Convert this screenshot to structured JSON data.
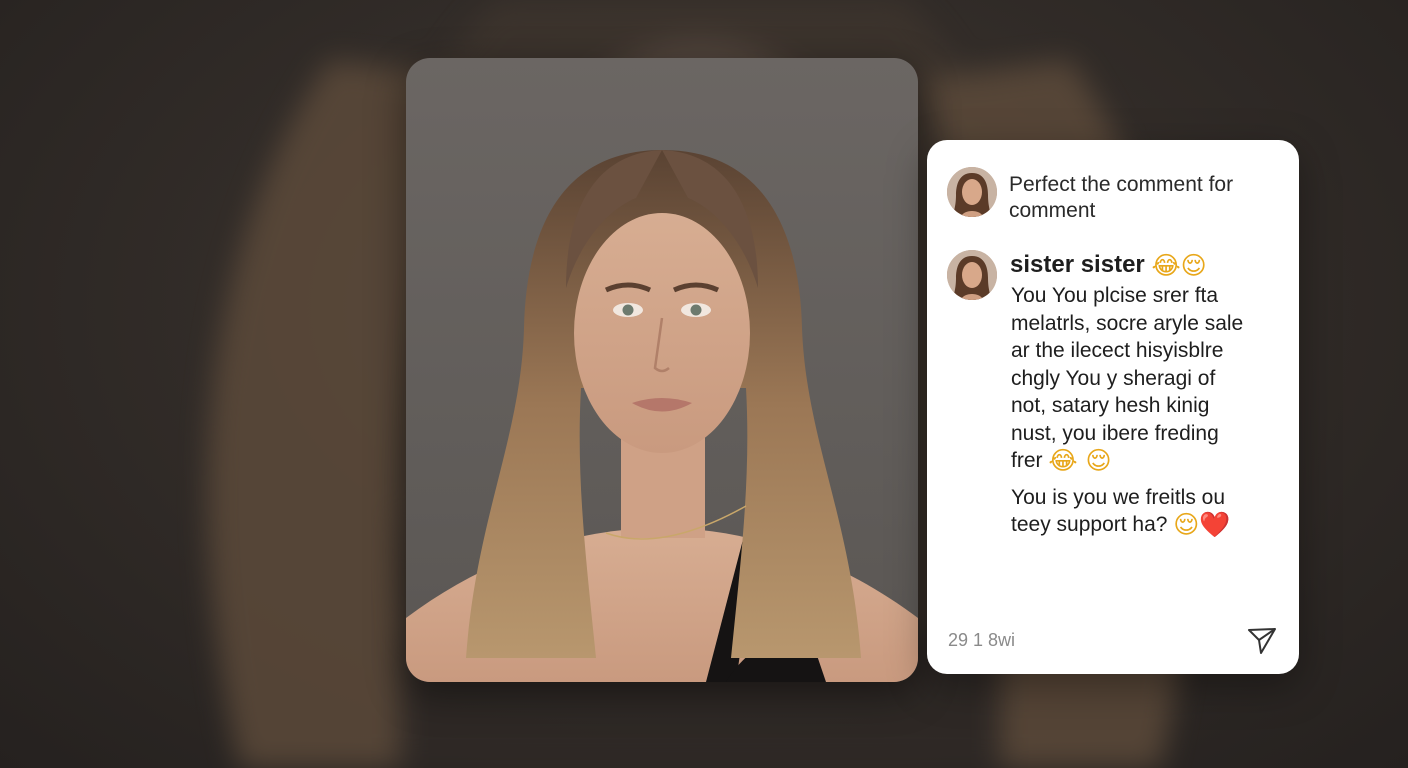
{
  "post": {
    "image": "portrait-photo"
  },
  "comments": {
    "prompt_text": "Perfect the comment for comment",
    "username": "sister sister",
    "username_emojis": "😂😌",
    "body_lines": [
      "You You plcise srer fta",
      "melatrls, socre aryle sale",
      "ar the ilecect hisyisblre",
      "chgly You y sheragi of",
      "not, satary hesh kinig",
      "nust, you ibere freding"
    ],
    "body_last_line_text": "frer",
    "body_last_line_emojis": "😂 😌",
    "second_line_1": "You is you we freitls ou",
    "second_line_2_text": "teey support ha?",
    "second_line_2_emoji": "😌",
    "second_line_2_heart": "❤️",
    "timestamp": "29 1 8wi",
    "send_icon": "send-icon",
    "avatar_icon": "avatar"
  },
  "colors": {
    "background": "#2b2725",
    "card": "#ffffff",
    "text": "#1e1e1e",
    "muted": "#8a8a8a"
  }
}
